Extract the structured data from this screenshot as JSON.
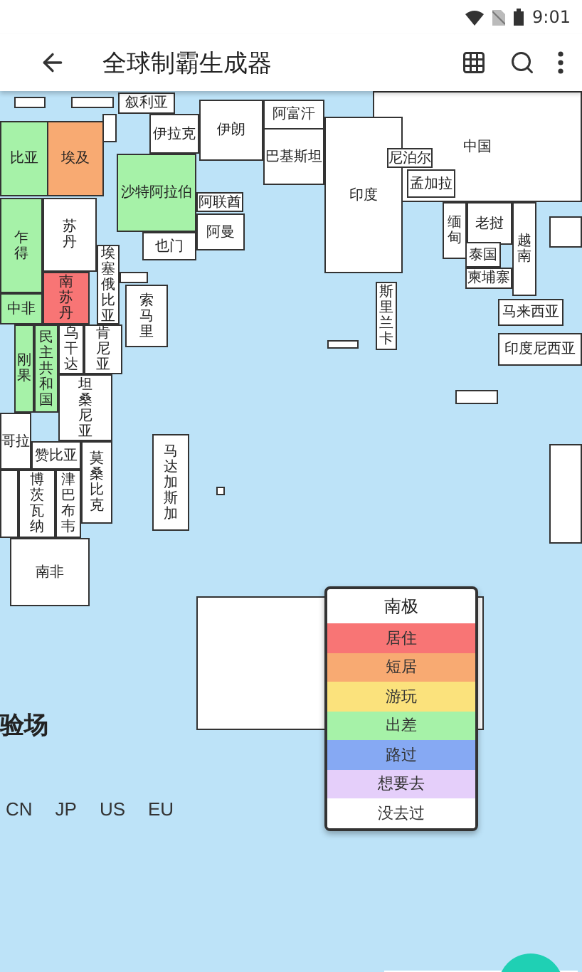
{
  "status_bar": {
    "time": "9:01"
  },
  "app_bar": {
    "title": "全球制霸生成器"
  },
  "countries": [
    {
      "name": "中国",
      "color": "#ffffff"
    },
    {
      "name": "叙利亚",
      "color": "#ffffff"
    },
    {
      "name": "伊朗",
      "color": "#ffffff"
    },
    {
      "name": "阿富汗",
      "color": "#ffffff"
    },
    {
      "name": "伊拉克",
      "color": "#ffffff"
    },
    {
      "name": "印度",
      "color": "#ffffff"
    },
    {
      "name": "比亚",
      "color": "#a6f2a8"
    },
    {
      "name": "埃及",
      "color": "#f8aa72"
    },
    {
      "name": "巴基斯坦",
      "color": "#ffffff"
    },
    {
      "name": "尼泊尔",
      "color": "#ffffff"
    },
    {
      "name": "沙特阿拉伯",
      "color": "#a6f2a8"
    },
    {
      "name": "孟加拉",
      "color": "#ffffff"
    },
    {
      "name": "阿联酋",
      "color": "#ffffff"
    },
    {
      "name": "乍得",
      "color": "#a6f2a8"
    },
    {
      "name": "苏丹",
      "color": "#ffffff"
    },
    {
      "name": "缅甸",
      "color": "#ffffff"
    },
    {
      "name": "老挝",
      "color": "#ffffff"
    },
    {
      "name": "越南",
      "color": "#ffffff"
    },
    {
      "name": "阿曼",
      "color": "#ffffff"
    },
    {
      "name": "也门",
      "color": "#ffffff"
    },
    {
      "name": "埃塞俄比亚",
      "color": "#ffffff"
    },
    {
      "name": "泰国",
      "color": "#ffffff"
    },
    {
      "name": "中非",
      "color": "#a6f2a8"
    },
    {
      "name": "南苏丹",
      "color": "#f87575"
    },
    {
      "name": "索马里",
      "color": "#ffffff"
    },
    {
      "name": "斯里兰卡",
      "color": "#ffffff"
    },
    {
      "name": "柬埔寨",
      "color": "#ffffff"
    },
    {
      "name": "马来西亚",
      "color": "#ffffff"
    },
    {
      "name": "刚果",
      "color": "#a6f2a8"
    },
    {
      "name": "民主共和国",
      "color": "#a6f2a8"
    },
    {
      "name": "乌干达",
      "color": "#ffffff"
    },
    {
      "name": "肯尼亚",
      "color": "#ffffff"
    },
    {
      "name": "印度尼西亚",
      "color": "#ffffff"
    },
    {
      "name": "坦桑尼亚",
      "color": "#ffffff"
    },
    {
      "name": "哥拉",
      "color": "#ffffff"
    },
    {
      "name": "赞比亚",
      "color": "#ffffff"
    },
    {
      "name": "博茨瓦纳",
      "color": "#ffffff"
    },
    {
      "name": "津巴布韦",
      "color": "#ffffff"
    },
    {
      "name": "莫桑比克",
      "color": "#ffffff"
    },
    {
      "name": "马达加斯加",
      "color": "#ffffff"
    },
    {
      "name": "南非",
      "color": "#ffffff"
    }
  ],
  "legend": {
    "title": "南极",
    "items": [
      {
        "label": "居住",
        "color": "#f87575"
      },
      {
        "label": "短居",
        "color": "#f8aa72"
      },
      {
        "label": "游玩",
        "color": "#fbe27c"
      },
      {
        "label": "出差",
        "color": "#a6f2a8"
      },
      {
        "label": "路过",
        "color": "#86a9f3"
      },
      {
        "label": "想要去",
        "color": "#e5cffa"
      },
      {
        "label": "没去过",
        "color": "#ffffff"
      }
    ]
  },
  "caption": "验场",
  "regions": [
    "CN",
    "JP",
    "US",
    "EU"
  ]
}
